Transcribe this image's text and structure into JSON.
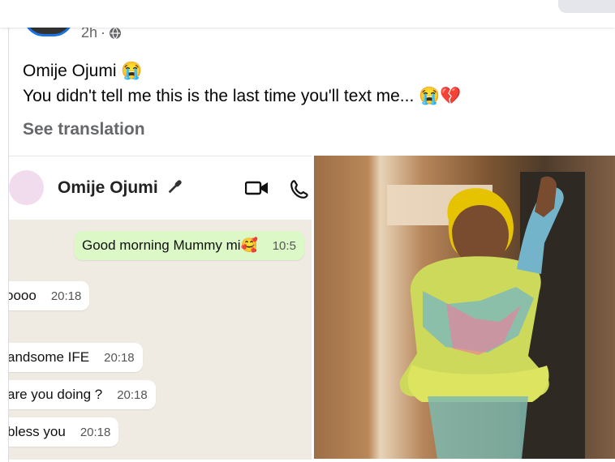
{
  "post": {
    "time": "2h",
    "meta_separator": "·",
    "author_line": "Omije Ojumi 😭",
    "message_line": "You didn't tell me this is the last time you'll text me... 😭💔",
    "see_translation": "See translation"
  },
  "chat": {
    "contact_name": "Omije Ojumi",
    "messages": [
      {
        "text": "Good morning Mummy mi🥰",
        "time": "10:5"
      },
      {
        "text": "oooo",
        "time": "20:18"
      },
      {
        "text": "andsome IFE",
        "time": "20:18"
      },
      {
        "text": "are you doing ?",
        "time": "20:18"
      },
      {
        "text": "bless you",
        "time": "20:18"
      }
    ]
  },
  "icons": {
    "globe": "globe-icon",
    "mic": "mic-icon",
    "video": "video-call-icon",
    "phone": "phone-icon"
  },
  "colors": {
    "accent": "#1b74e4",
    "chat_bg": "#efeae2",
    "outgoing": "#dcf8c6"
  }
}
